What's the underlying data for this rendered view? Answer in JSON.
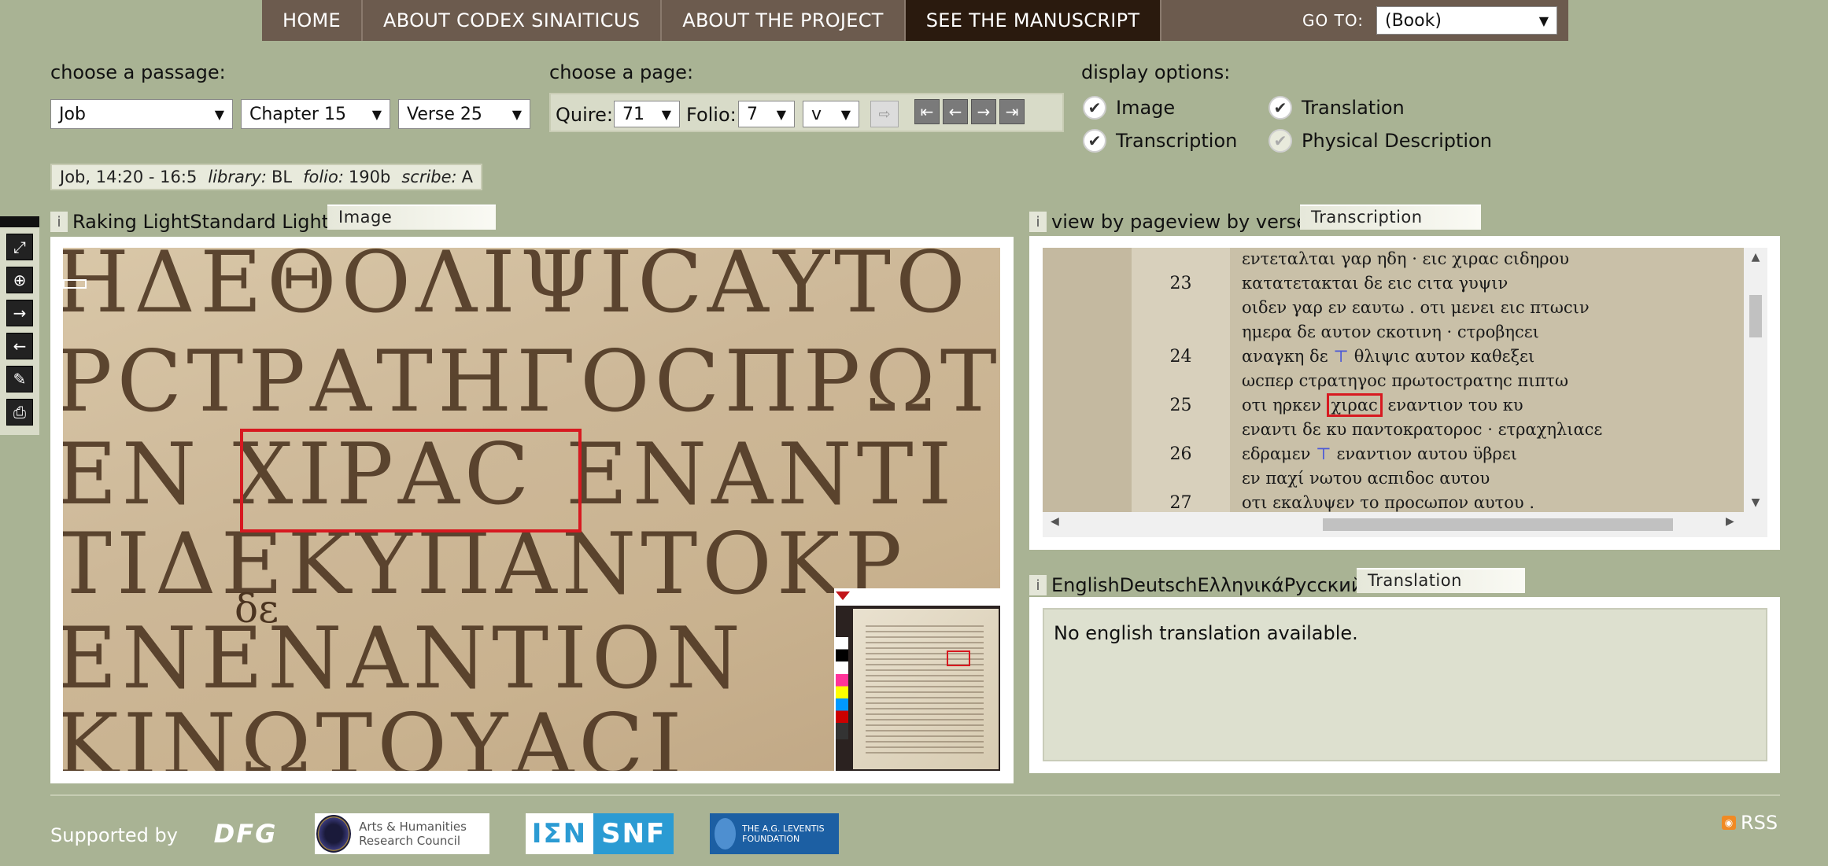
{
  "nav": {
    "items": [
      "HOME",
      "ABOUT CODEX SINAITICUS",
      "ABOUT THE PROJECT",
      "SEE THE MANUSCRIPT"
    ],
    "active": "SEE THE MANUSCRIPT",
    "goto_label": "GO TO:",
    "goto_value": "(Book)"
  },
  "passage": {
    "label": "choose a passage:",
    "book": "Job",
    "chapter": "Chapter 15",
    "verse": "Verse 25"
  },
  "page": {
    "label": "choose a page:",
    "quire_label": "Quire:",
    "quire_value": "71",
    "folio_label": "Folio:",
    "folio_value": "7",
    "side_value": "v"
  },
  "display": {
    "label": "display options:",
    "options": [
      "Image",
      "Translation",
      "Transcription",
      "Physical Description"
    ]
  },
  "info": {
    "passage": "Job, 14:20 - 16:5",
    "library_label": "library:",
    "library_value": "BL",
    "folio_label": "folio:",
    "folio_value": "190b",
    "scribe_label": "scribe:",
    "scribe_value": "A"
  },
  "image_panel": {
    "info": "i",
    "options": "Raking LightStandard Light",
    "tab": "Image",
    "lines": [
      "ΗΔΕΘΟΛΙΨΙCΑΥΤΟ",
      "ΡCΤΡΑΤΗΓΟCΠΡΩΤ",
      "ΕΝ ΧΙΡΑC ΕΝΑΝΤΙ",
      "ΤΙΔΕΚΥΠΑΝΤΟΚΡ",
      "ΕΝΕΝΑΝΤΙΟΝ",
      "ΚΙΝΩΤΟΥΑCΙ"
    ],
    "marginal": "δε"
  },
  "transcription_panel": {
    "info": "i",
    "options": "view by pageview by verse",
    "tab": "Transcription",
    "rows": [
      {
        "num": "",
        "text": "εντεταλται γαρ ηδη · ειc χιραc cιδηρου"
      },
      {
        "num": "23",
        "text": "κατατετακται δε ειc cιτα γυψιν"
      },
      {
        "num": "",
        "text": "οιδεν γαρ εν εαυτω . οτι μενει ειc πτωcιν"
      },
      {
        "num": "",
        "text": "ημερα δε αυτον cκοτινη · cτροβηcει"
      },
      {
        "num": "24",
        "pre": "αναγκη δε ",
        "mark": "⊤",
        "post": " θλιψιc αυτον καθεξει"
      },
      {
        "num": "",
        "text": "ωcπερ cτρατηγοc πρωτοcτρατηc πιπτω"
      },
      {
        "num": "25",
        "pre": "οτι ηρκεν ",
        "hl": "χιραc",
        "post": " εναντιον του κυ"
      },
      {
        "num": "",
        "text": "εναντι δε κυ παντοκρατοροc · ετραχηλιαcε"
      },
      {
        "num": "26",
        "pre": "εδραμεν ",
        "mark": "⊤",
        "post": " εναντιον αυτου ϋβρει"
      },
      {
        "num": "",
        "text": "εν παχί νωτου αcπιδοc αυτου"
      },
      {
        "num": "27",
        "text": "οτι εκαλυψεν το προcωπον αυτου ."
      }
    ]
  },
  "translation_panel": {
    "info": "i",
    "options": "EnglishDeutschΕλληνικάРусский",
    "tab": "Translation",
    "text": "No english translation available."
  },
  "footer": {
    "supported_by": "Supported by",
    "logos": [
      "DFG",
      "Arts & Humanities Research Council",
      "ΙΣΝ",
      "SNF",
      "THE A.G. LEVENTIS FOUNDATION"
    ],
    "rss": "RSS"
  }
}
